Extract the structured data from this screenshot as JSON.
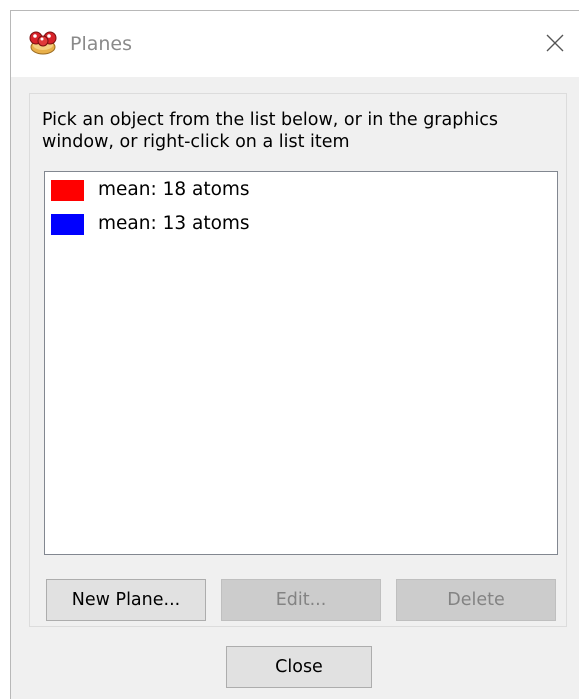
{
  "window": {
    "title": "Planes",
    "app_icon": "chimera-icon",
    "close_icon": "close-icon"
  },
  "instructions": "Pick an object from the list below, or in the graphics window, or right-click on a list item",
  "planes": [
    {
      "label": "mean: 18 atoms",
      "color": "#ff0000"
    },
    {
      "label": "mean: 13 atoms",
      "color": "#0000ff"
    }
  ],
  "buttons": {
    "new_plane": "New Plane...",
    "edit": "Edit...",
    "delete": "Delete",
    "close": "Close"
  }
}
